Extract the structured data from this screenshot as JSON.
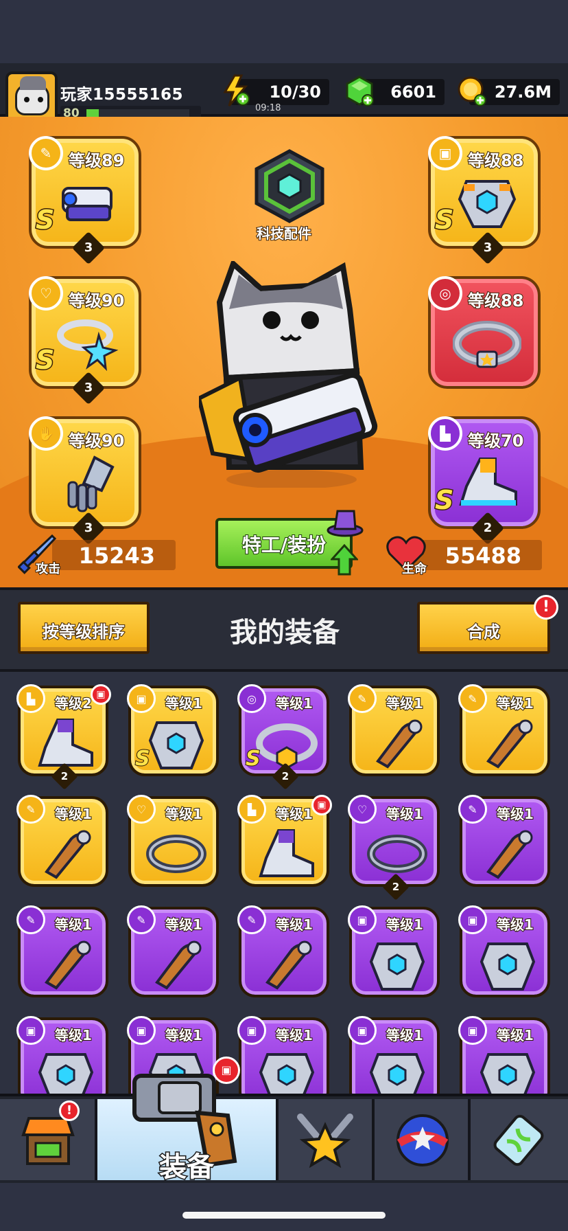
{
  "player": {
    "name": "玩家15555165",
    "level": "80",
    "xp_progress": 0.12
  },
  "resources": {
    "energy": "10/30",
    "energy_timer": "09:18",
    "gems": "6601",
    "gold": "27.6M"
  },
  "tech_parts": {
    "label": "科技配件"
  },
  "equipped": {
    "weapon": {
      "label": "等级89",
      "rank": "S",
      "stars": "3",
      "type_icon": "weapon-type-icon"
    },
    "armor": {
      "label": "等级88",
      "rank": "S",
      "stars": "3",
      "type_icon": "armor-type-icon"
    },
    "necklace": {
      "label": "等级90",
      "rank": "S",
      "stars": "3",
      "type_icon": "necklace-type-icon"
    },
    "belt": {
      "label": "等级88",
      "type_icon": "belt-type-icon"
    },
    "gloves": {
      "label": "等级90",
      "stars": "3",
      "type_icon": "glove-type-icon"
    },
    "boots": {
      "label": "等级70",
      "rank": "S",
      "stars": "2",
      "type_icon": "boot-type-icon"
    }
  },
  "stats": {
    "attack_label": "攻击",
    "attack_value": "15243",
    "hp_label": "生命",
    "hp_value": "55488"
  },
  "agent_button": "特工/装扮",
  "equipment": {
    "title": "我的装备",
    "sort_button": "按等级排序",
    "merge_button": "合成",
    "merge_alert": "!"
  },
  "grid": [
    {
      "label": "等级2",
      "color": "yellow",
      "type": "boot",
      "stars": "2",
      "new": true
    },
    {
      "label": "等级1",
      "color": "yellow",
      "type": "armor",
      "rank": "S"
    },
    {
      "label": "等级1",
      "color": "purple",
      "type": "belt",
      "rank": "S",
      "stars": "2"
    },
    {
      "label": "等级1",
      "color": "yellow",
      "type": "weapon"
    },
    {
      "label": "等级1",
      "color": "yellow",
      "type": "weapon"
    },
    {
      "label": "等级1",
      "color": "yellow",
      "type": "weapon"
    },
    {
      "label": "等级1",
      "color": "yellow",
      "type": "necklace"
    },
    {
      "label": "等级1",
      "color": "yellow",
      "type": "boot",
      "new": true
    },
    {
      "label": "等级1",
      "color": "purple",
      "type": "necklace",
      "stars": "2"
    },
    {
      "label": "等级1",
      "color": "purple",
      "type": "weapon"
    },
    {
      "label": "等级1",
      "color": "purple",
      "type": "weapon"
    },
    {
      "label": "等级1",
      "color": "purple",
      "type": "weapon"
    },
    {
      "label": "等级1",
      "color": "purple",
      "type": "weapon"
    },
    {
      "label": "等级1",
      "color": "purple",
      "type": "armor"
    },
    {
      "label": "等级1",
      "color": "purple",
      "type": "armor"
    },
    {
      "label": "等级1",
      "color": "purple",
      "type": "armor"
    },
    {
      "label": "等级1",
      "color": "purple",
      "type": "armor"
    },
    {
      "label": "等级1",
      "color": "purple",
      "type": "armor"
    },
    {
      "label": "等级1",
      "color": "purple",
      "type": "armor"
    },
    {
      "label": "等级1",
      "color": "purple",
      "type": "armor"
    }
  ],
  "nav": {
    "active_label": "装备",
    "items": [
      "shop-icon",
      "equipment-icon",
      "battle-icon",
      "talent-icon",
      "gene-icon"
    ]
  },
  "colors": {
    "stage": "#f59b2c",
    "slot_yellow": "#f5b418",
    "slot_purple": "#8a2fd4",
    "slot_red": "#d32c3a",
    "accent_green": "#5fc52a"
  }
}
